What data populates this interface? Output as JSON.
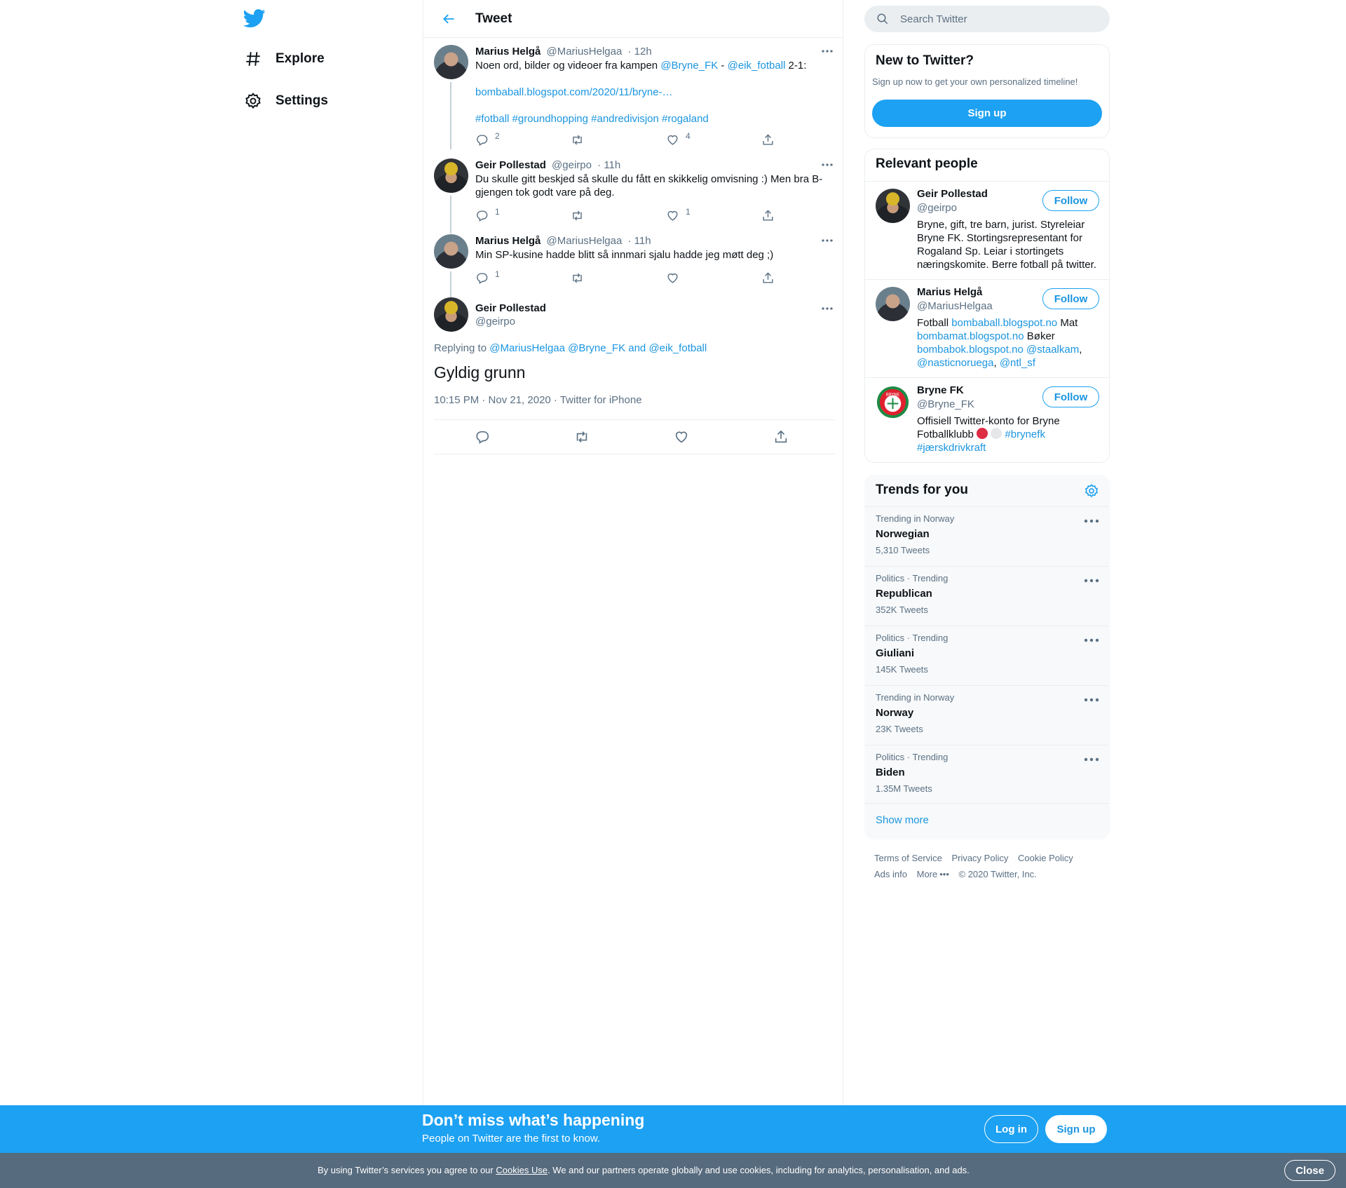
{
  "nav": {
    "explore_label": "Explore",
    "settings_label": "Settings"
  },
  "header": {
    "title": "Tweet"
  },
  "thread": [
    {
      "name": "Marius Helgå",
      "handle": "@MariusHelgaa",
      "time": "12h",
      "text_before": "Noen ord, bilder og videoer fra kampen ",
      "mention1": "@Bryne_FK",
      "sep": " - ",
      "mention2": "@eik_fotball",
      "text_after": " 2-1:",
      "link": "bombaball.blogspot.com/2020/11/bryne-…",
      "hashtags": "#fotball #groundhopping #andredivisjon #rogaland",
      "replies": "2",
      "retweets": "",
      "likes": "4"
    },
    {
      "name": "Geir Pollestad",
      "handle": "@geirpo",
      "time": "11h",
      "text": "Du skulle gitt beskjed så skulle du fått en skikkelig omvisning :) Men bra B-gjengen tok godt vare på deg.",
      "replies": "1",
      "retweets": "",
      "likes": "1"
    },
    {
      "name": "Marius Helgå",
      "handle": "@MariusHelgaa",
      "time": "11h",
      "text": "Min SP-kusine hadde blitt så innmari sjalu hadde jeg møtt deg ;)",
      "replies": "1",
      "retweets": "",
      "likes": ""
    }
  ],
  "focus": {
    "name": "Geir Pollestad",
    "handle": "@geirpo",
    "replying_prefix": "Replying to ",
    "replying_mentions": "@MariusHelgaa @Bryne_FK and @eik_fotball",
    "text": "Gyldig grunn",
    "timestamp": "10:15 PM · Nov 21, 2020 · Twitter for iPhone"
  },
  "search": {
    "placeholder": "Search Twitter"
  },
  "new_to_twitter": {
    "title": "New to Twitter?",
    "subtitle": "Sign up now to get your own personalized timeline!",
    "button": "Sign up"
  },
  "relevant": {
    "title": "Relevant people",
    "follow_label": "Follow",
    "people": [
      {
        "name": "Geir Pollestad",
        "handle": "@geirpo",
        "bio": "Bryne, gift, tre barn, jurist. Styreleiar Bryne FK. Stortingsrepresentant for Rogaland Sp. Leiar i stortingets næringskomite. Berre fotball på twitter."
      },
      {
        "name": "Marius Helgå",
        "handle": "@MariusHelgaa",
        "bio_1": "Fotball ",
        "bio_link1": "bombaball.blogspot.no",
        "bio_2": " Mat ",
        "bio_link2": "bombamat.blogspot.no",
        "bio_3": " Bøker ",
        "bio_link3": "bombabok.blogspot.no",
        "bio_4": " ",
        "bio_link4": "@staalkam",
        "bio_5": ", ",
        "bio_link5": "@nasticnoruega",
        "bio_6": ", ",
        "bio_link6": "@ntl_sf"
      },
      {
        "name": "Bryne FK",
        "handle": "@Bryne_FK",
        "bio_1": "Offisiell Twitter-konto for Bryne Fotballklubb ",
        "bio_link1": "#brynefk",
        "bio_link2": "#jærskdrivkraft",
        "logo_text": "BRYNE"
      }
    ]
  },
  "trends": {
    "title": "Trends for you",
    "items": [
      {
        "context": "Trending in Norway",
        "name": "Norwegian",
        "count": "5,310 Tweets"
      },
      {
        "context": "Politics · Trending",
        "name": "Republican",
        "count": "352K Tweets"
      },
      {
        "context": "Politics · Trending",
        "name": "Giuliani",
        "count": "145K Tweets"
      },
      {
        "context": "Trending in Norway",
        "name": "Norway",
        "count": "23K Tweets"
      },
      {
        "context": "Politics · Trending",
        "name": "Biden",
        "count": "1.35M Tweets"
      }
    ],
    "show_more": "Show more"
  },
  "footer": {
    "terms": "Terms of Service",
    "privacy": "Privacy Policy",
    "cookie": "Cookie Policy",
    "ads": "Ads info",
    "more": "More",
    "copyright": "© 2020 Twitter, Inc."
  },
  "cta": {
    "title": "Don’t miss what’s happening",
    "subtitle": "People on Twitter are the first to know.",
    "login": "Log in",
    "signup": "Sign up"
  },
  "cookie_bar": {
    "text_before": "By using Twitter’s services you agree to our ",
    "link": "Cookies Use",
    "text_after": ". We and our partners operate globally and use cookies, including for analytics, personalisation, and ads.",
    "close": "Close"
  },
  "colors": {
    "accent": "#1da1f2",
    "link": "#1b95e0",
    "muted": "#5b7083",
    "cookie_bg": "#576b7e"
  },
  "icons": {
    "logo": "twitter-bird-icon",
    "explore": "hashtag-icon",
    "settings": "gear-icon",
    "back": "arrow-left-icon",
    "reply": "reply-icon",
    "retweet": "retweet-icon",
    "like": "heart-icon",
    "share": "share-icon",
    "more": "more-dots-icon",
    "search": "search-icon"
  }
}
